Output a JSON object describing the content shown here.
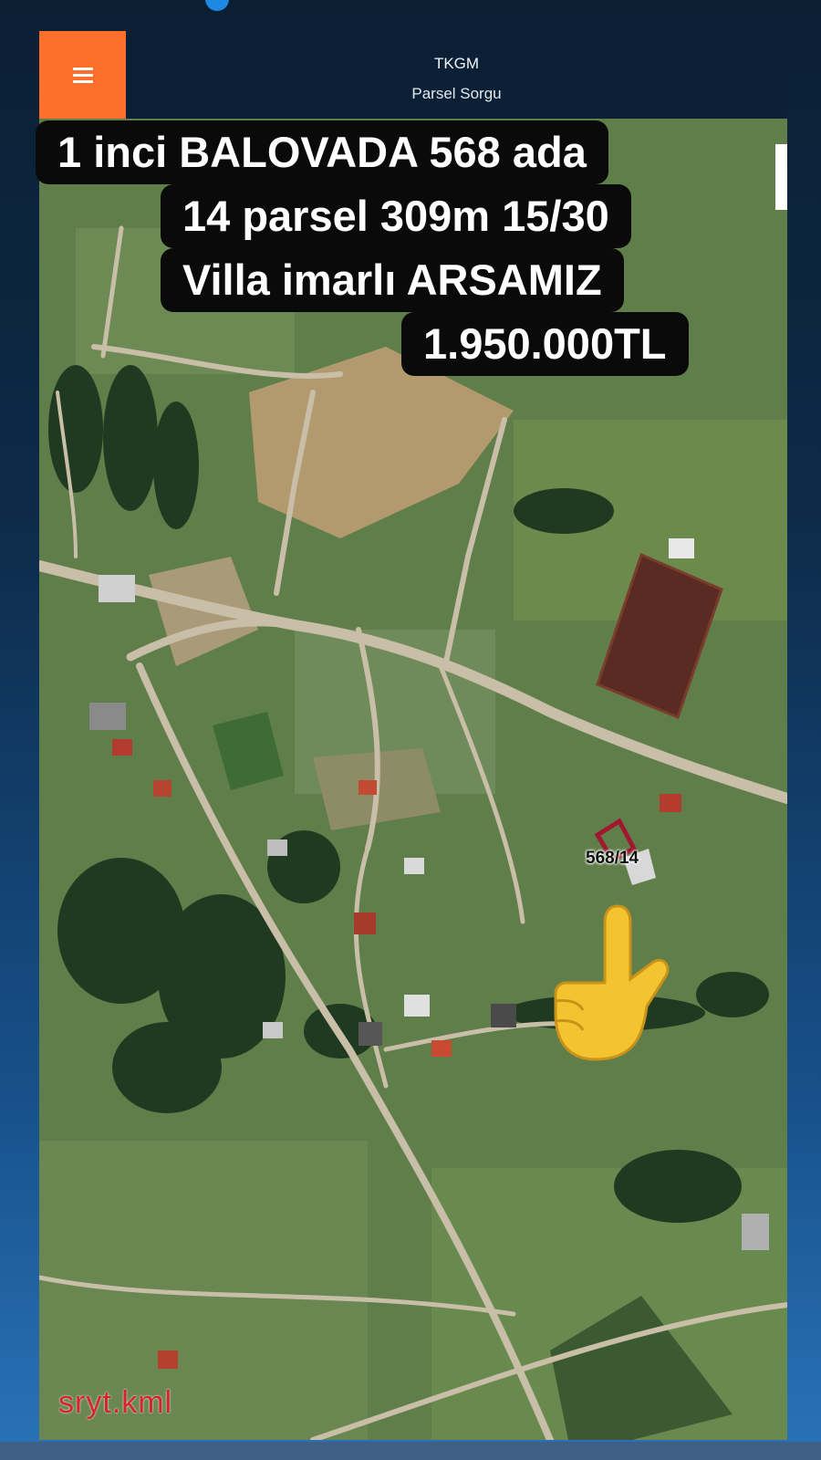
{
  "header": {
    "title": "TKGM",
    "subtitle": "Parsel Sorgu"
  },
  "caption": {
    "line1": "1 inci BALOVADA  568 ada",
    "line2": "14 parsel 309m 15/30",
    "line3": "Villa imarlı ARSAMIZ",
    "line4": "1.950.000TL"
  },
  "map": {
    "parcel_label": "568/14",
    "watermark": "sryt.kml"
  },
  "icons": {
    "menu": "hamburger-menu-icon",
    "pointer": "pointing-up-hand-icon"
  },
  "colors": {
    "menu_button": "#ff6f2c",
    "caption_bg": "#0a0a0a",
    "parcel_outline": "#a01830",
    "watermark": "#d8232a"
  }
}
